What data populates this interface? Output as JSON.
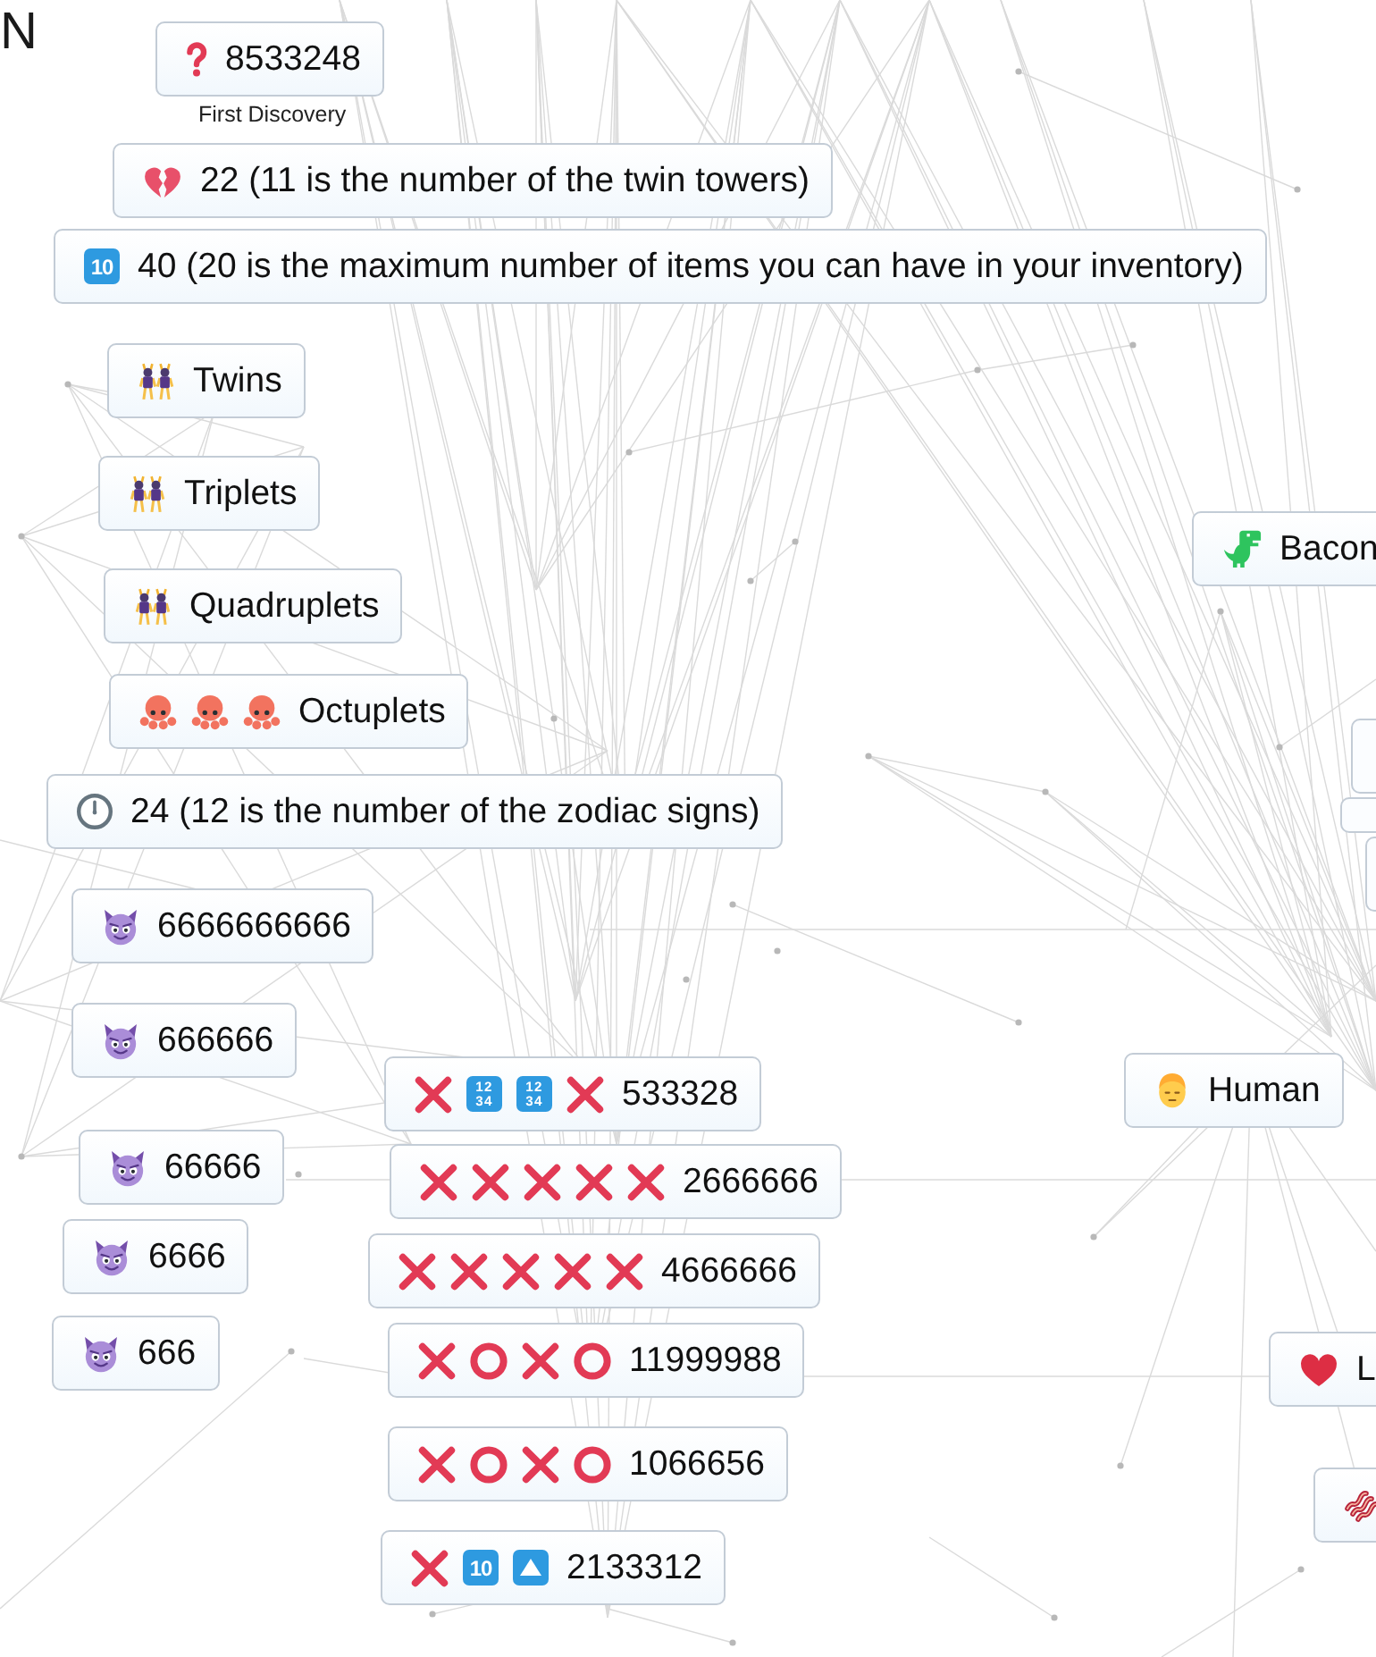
{
  "logo_fragment": "N",
  "elements": [
    {
      "text": "8533248",
      "icons": [
        {
          "kind": "question"
        }
      ],
      "caption": "First Discovery"
    },
    {
      "text": "22 (11 is the number of the twin towers)",
      "icons": [
        {
          "kind": "broken-heart"
        }
      ]
    },
    {
      "text": "40 (20 is the maximum number of items you can have in your inventory)",
      "icons": [
        {
          "kind": "keycap",
          "label": "10"
        }
      ]
    },
    {
      "text": "Twins",
      "icons": [
        {
          "kind": "dancers"
        }
      ]
    },
    {
      "text": "Triplets",
      "icons": [
        {
          "kind": "dancers"
        }
      ]
    },
    {
      "text": "Bacon",
      "icons": [
        {
          "kind": "dinosaur"
        }
      ]
    },
    {
      "text": "Quadruplets",
      "icons": [
        {
          "kind": "dancers"
        }
      ]
    },
    {
      "text": "Octuplets",
      "icons": [
        {
          "kind": "octopus"
        },
        {
          "kind": "octopus"
        },
        {
          "kind": "octopus"
        }
      ]
    },
    {
      "text": "24 (12 is the number of the zodiac signs)",
      "icons": [
        {
          "kind": "clock"
        }
      ]
    },
    {
      "text": "6666666666",
      "icons": [
        {
          "kind": "devil"
        }
      ]
    },
    {
      "text": "666666",
      "icons": [
        {
          "kind": "devil"
        }
      ]
    },
    {
      "text": "Human",
      "icons": [
        {
          "kind": "person"
        }
      ]
    },
    {
      "text": "533328",
      "icons": [
        {
          "kind": "cross"
        },
        {
          "kind": "input-numbers",
          "lines": [
            "12",
            "34"
          ]
        },
        {
          "kind": "input-numbers",
          "lines": [
            "12",
            "34"
          ]
        },
        {
          "kind": "cross"
        }
      ]
    },
    {
      "text": "66666",
      "icons": [
        {
          "kind": "devil"
        }
      ]
    },
    {
      "text": "2666666",
      "icons": [
        {
          "kind": "cross"
        },
        {
          "kind": "cross"
        },
        {
          "kind": "cross"
        },
        {
          "kind": "cross"
        },
        {
          "kind": "cross"
        }
      ]
    },
    {
      "text": "6666",
      "icons": [
        {
          "kind": "devil"
        }
      ]
    },
    {
      "text": "4666666",
      "icons": [
        {
          "kind": "cross"
        },
        {
          "kind": "cross"
        },
        {
          "kind": "cross"
        },
        {
          "kind": "cross"
        },
        {
          "kind": "cross"
        }
      ]
    },
    {
      "text": "666",
      "icons": [
        {
          "kind": "devil"
        }
      ]
    },
    {
      "text": "11999988",
      "icons": [
        {
          "kind": "cross"
        },
        {
          "kind": "ring"
        },
        {
          "kind": "cross"
        },
        {
          "kind": "ring"
        }
      ]
    },
    {
      "text": "L",
      "icons": [
        {
          "kind": "heart"
        }
      ]
    },
    {
      "text": "1066656",
      "icons": [
        {
          "kind": "cross"
        },
        {
          "kind": "ring"
        },
        {
          "kind": "cross"
        },
        {
          "kind": "ring"
        }
      ]
    },
    {
      "icons": [
        {
          "kind": "bacon"
        }
      ]
    },
    {
      "text": "2133312",
      "icons": [
        {
          "kind": "cross"
        },
        {
          "kind": "keycap",
          "label": "10"
        },
        {
          "kind": "up-button"
        }
      ]
    }
  ]
}
